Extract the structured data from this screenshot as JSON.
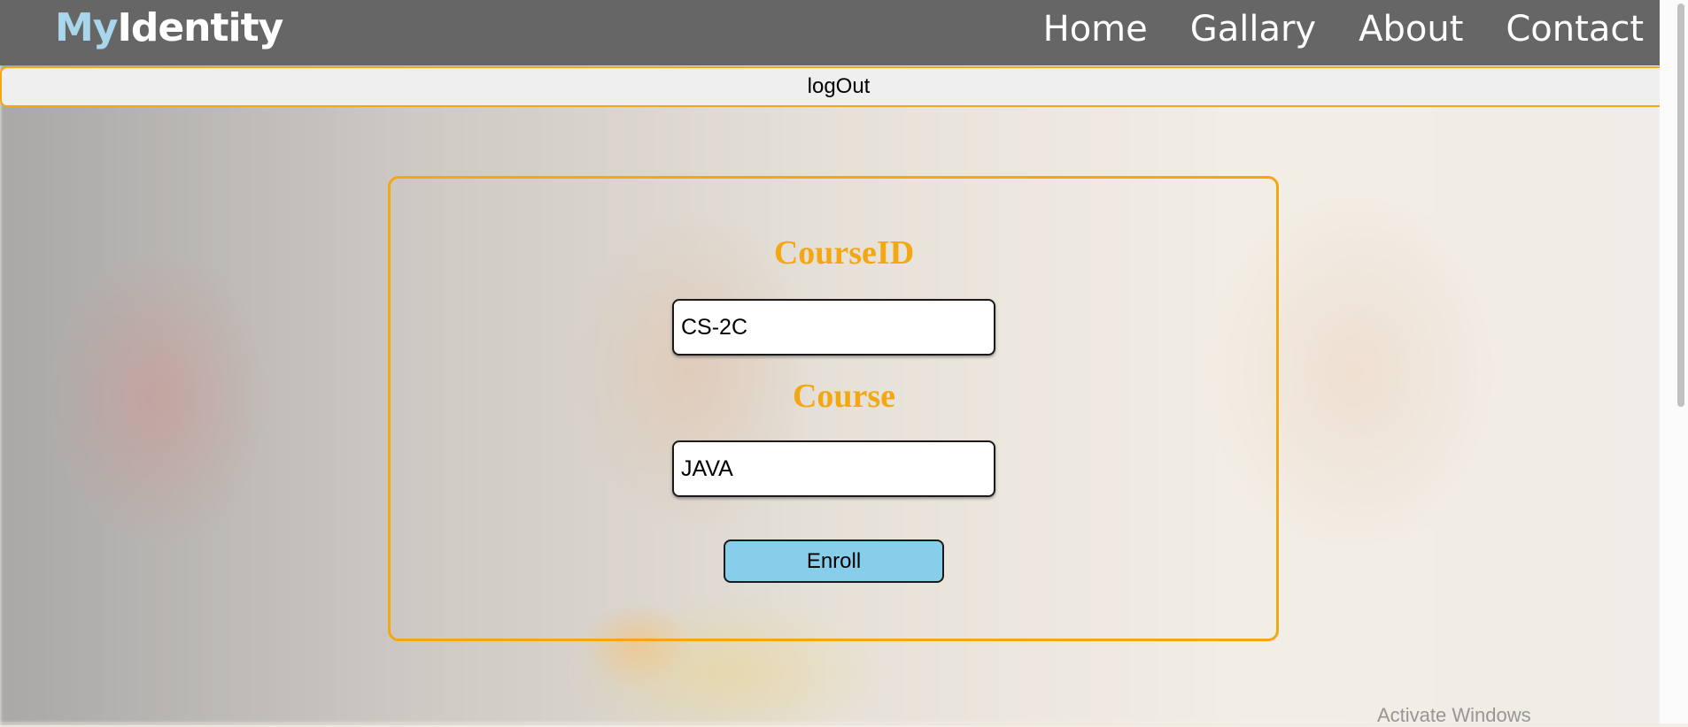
{
  "header": {
    "logo_my": "My",
    "logo_identity": "Identity",
    "nav": [
      "Home",
      "Gallary",
      "About",
      "Contact"
    ]
  },
  "logout_label": "logOut",
  "form": {
    "course_id_label": "CourseID",
    "course_id_value": "CS-2C",
    "course_label": "Course",
    "course_value": "JAVA",
    "enroll_label": "Enroll"
  },
  "watermark": "Activate Windows",
  "colors": {
    "nav_bg": "#666666",
    "accent_orange": "#f3a712",
    "logo_my": "#a9d6ec",
    "enroll_bg": "#87ceeb"
  }
}
